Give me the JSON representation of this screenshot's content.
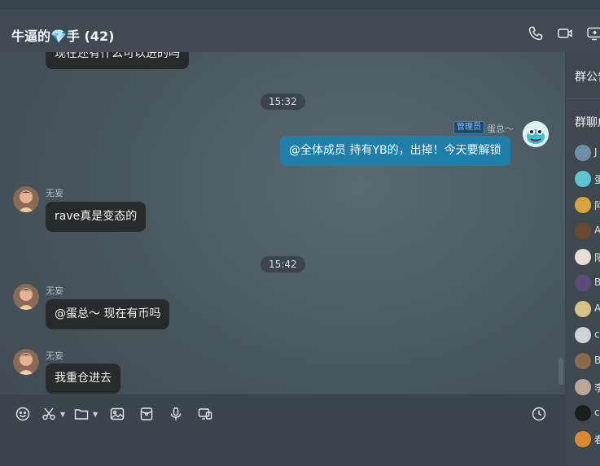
{
  "header": {
    "title": "牛逼的💎手 (42)"
  },
  "messages": {
    "partial_top": "现在还有什么可以进的吗",
    "time1": "15:32",
    "admin_tag": "管理员",
    "admin_name": "蛋总～",
    "admin_msg": "@全体成员 持有YB的，出掉！今天要解锁",
    "sender1": "无妄",
    "msg1": "rave真是变态的",
    "time2": "15:42",
    "sender2": "无妄",
    "msg2": "@蛋总～ 现在有币吗",
    "sender3": "无妄",
    "msg3": "我重仓进去"
  },
  "sidebar": {
    "announcement": "群公告",
    "members_title": "群聊成员",
    "members": [
      {
        "name": "J",
        "color": "#6f8fa6"
      },
      {
        "name": "蛋",
        "color": "#5cc6d0"
      },
      {
        "name": "阿",
        "color": "#d9a53a"
      },
      {
        "name": "A",
        "color": "#6b4a2f"
      },
      {
        "name": "阳",
        "color": "#e8ddd2"
      },
      {
        "name": "B",
        "color": "#5a4a7a"
      },
      {
        "name": "A",
        "color": "#d4c28a"
      },
      {
        "name": "c",
        "color": "#cfd3d6"
      },
      {
        "name": "B",
        "color": "#8a6a4a"
      },
      {
        "name": "李",
        "color": "#b9a79a"
      },
      {
        "name": "c",
        "color": "#1f1f1f"
      },
      {
        "name": "春",
        "color": "#d9892f"
      }
    ]
  },
  "colors": {
    "mine_bubble": "#1f7fa8",
    "other_bubble": "#262b2e",
    "admin_tag": "#7fc3ff"
  }
}
